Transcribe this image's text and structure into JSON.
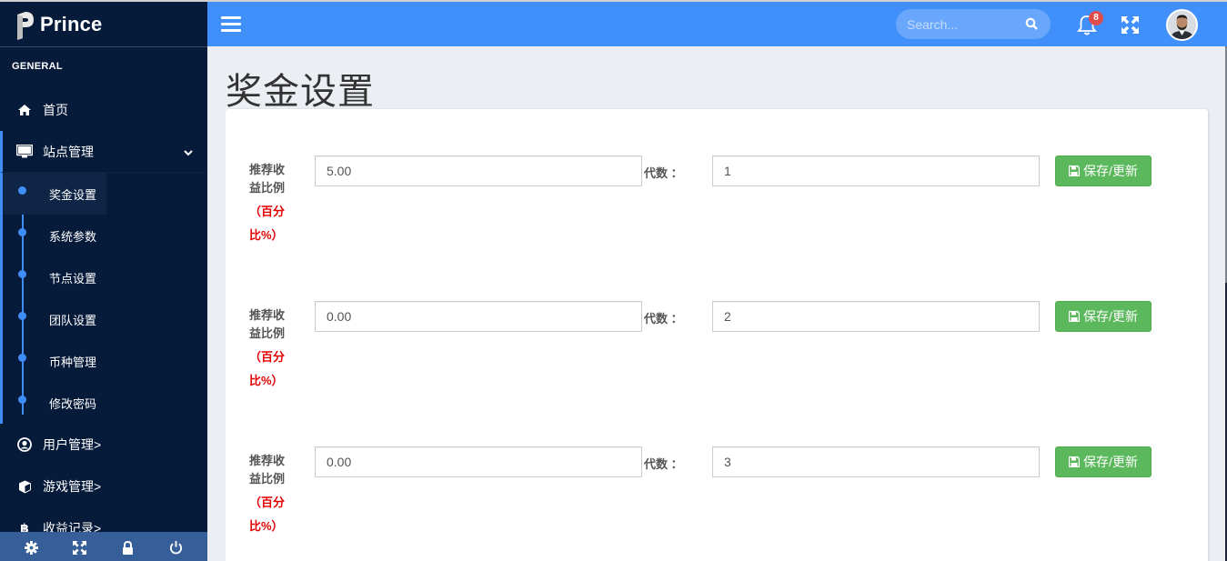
{
  "brand": {
    "name": "Prince"
  },
  "sidebar": {
    "section_title": "GENERAL",
    "items": [
      {
        "label": "首页",
        "icon": "home-icon"
      },
      {
        "label": "站点管理",
        "icon": "monitor-icon",
        "expanded": true,
        "children": [
          {
            "label": "奖金设置",
            "active": true
          },
          {
            "label": "系统参数"
          },
          {
            "label": "节点设置"
          },
          {
            "label": "团队设置"
          },
          {
            "label": "币种管理"
          },
          {
            "label": "修改密码"
          }
        ]
      },
      {
        "label": "用户管理>",
        "icon": "user-circle-icon"
      },
      {
        "label": "游戏管理>",
        "icon": "cube-icon"
      },
      {
        "label": "收益记录>",
        "icon": "bitcoin-icon"
      }
    ],
    "footer_icons": [
      "gear-icon",
      "expand-icon",
      "lock-icon",
      "power-icon"
    ]
  },
  "topbar": {
    "search_placeholder": "Search...",
    "notification_count": "8"
  },
  "page": {
    "title": "奖金设置"
  },
  "form": {
    "label_main": "推荐收益比例",
    "label_unit": "（百分比%）",
    "generation_label": "代数 ：",
    "save_label": "保存/更新",
    "rows": [
      {
        "ratio": "5.00",
        "generation": "1"
      },
      {
        "ratio": "0.00",
        "generation": "2"
      },
      {
        "ratio": "0.00",
        "generation": "3"
      }
    ]
  },
  "colors": {
    "sidebar_bg": "#061a3a",
    "accent": "#418ffb",
    "save_button": "#5cb85c",
    "badge": "#e04b4b",
    "unit_text": "#e50000"
  }
}
